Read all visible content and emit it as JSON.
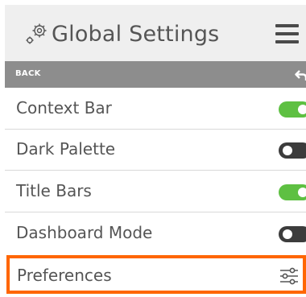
{
  "header": {
    "title": "Global Settings",
    "gear_icon": "gears-icon",
    "menu_icon": "hamburger-menu-icon"
  },
  "backbar": {
    "label": "BACK",
    "icon": "back-arrow-icon"
  },
  "settings": {
    "items": [
      {
        "label": "Context Bar",
        "enabled": true
      },
      {
        "label": "Dark Palette",
        "enabled": false
      },
      {
        "label": "Title Bars",
        "enabled": true
      },
      {
        "label": "Dashboard Mode",
        "enabled": false
      }
    ],
    "preferences": {
      "label": "Preferences",
      "icon": "sliders-icon"
    }
  },
  "colors": {
    "toggle_on": "#5ec042",
    "toggle_off": "#3c3c3c",
    "highlight": "#ff6600",
    "backbar": "#8d8d8d",
    "header": "#efefef"
  }
}
